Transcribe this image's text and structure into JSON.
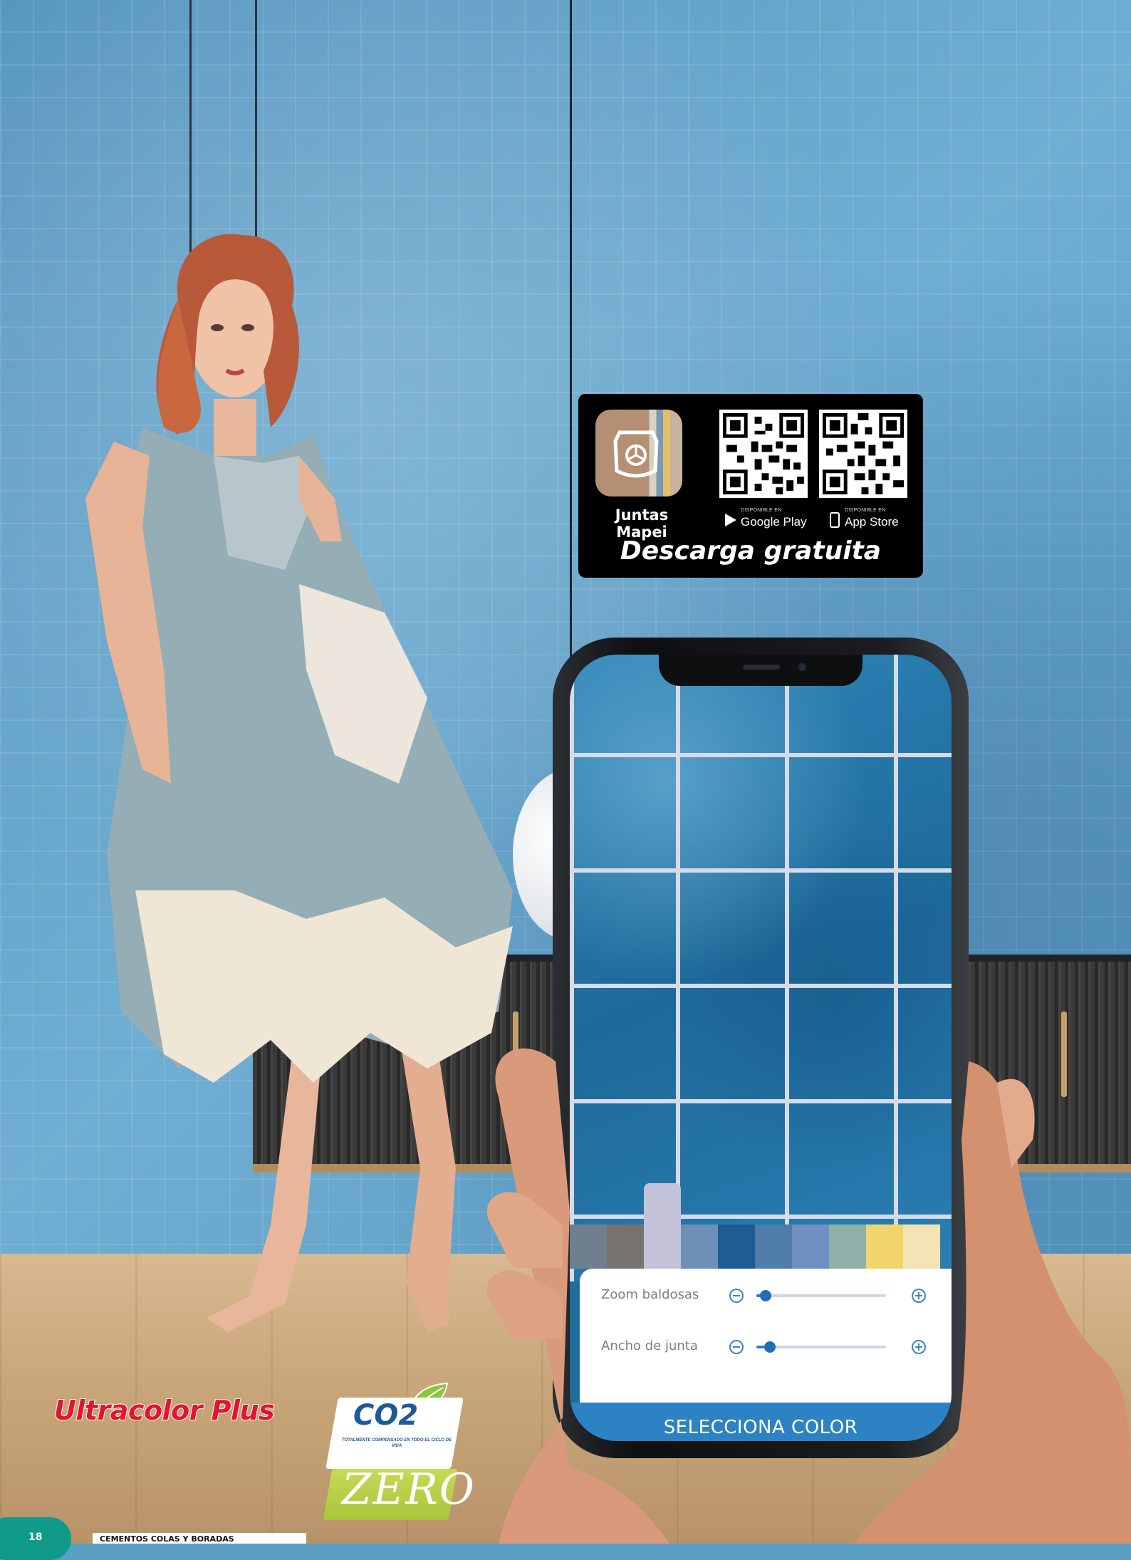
{
  "promo": {
    "app_name": "Juntas Mapei",
    "google_play_small": "DISPONIBLE EN",
    "google_play_name": "Google Play",
    "app_store_small": "DISPONIBLE EN",
    "app_store_name": "App Store",
    "tagline": "Descarga gratuita"
  },
  "phone_app": {
    "zoom_label": "Zoom baldosas",
    "zoom_level": 0.05,
    "joint_label": "Ancho de junta",
    "joint_level": 0.08,
    "cta_label": "SELECCIONA COLOR",
    "swatch_colors": [
      "#6f7f8f",
      "#77746f",
      "#c4c2d8",
      "#6e90b8",
      "#1f5c94",
      "#4f7ea8",
      "#6f8fc2",
      "#8fb0a8",
      "#f2d56a",
      "#f4e3b4"
    ],
    "selected_swatch": 2
  },
  "branding": {
    "product_name": "Ultracolor Plus",
    "co2_badge": "CO2",
    "co2_subtext": "TOTALMENTE COMPENSADO EN TODO EL CICLO DE VIDA",
    "co2_zero": "ZERO"
  },
  "footer": {
    "section_title": "CEMENTOS COLAS Y BORADAS",
    "page_number": "18"
  },
  "colors": {
    "accent": "#2d82c3",
    "brand_red": "#e3142c",
    "page_tab": "#0f9a8a"
  }
}
